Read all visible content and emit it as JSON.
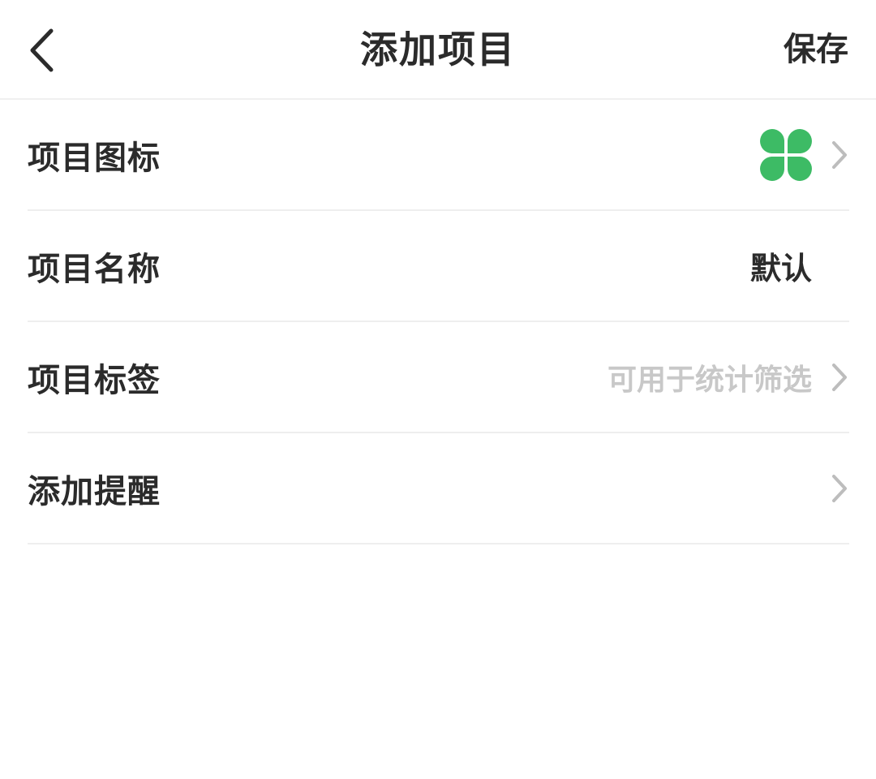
{
  "header": {
    "title": "添加项目",
    "save_label": "保存",
    "back_icon": "chevron-left-icon"
  },
  "rows": [
    {
      "label": "项目图标",
      "icon": "clover-icon",
      "icon_color": "#3dbb65",
      "has_chevron": true
    },
    {
      "label": "项目名称",
      "value": "默认",
      "has_chevron": false
    },
    {
      "label": "项目标签",
      "placeholder": "可用于统计筛选",
      "has_chevron": true
    },
    {
      "label": "添加提醒",
      "has_chevron": true
    }
  ],
  "colors": {
    "text": "#2b2b2b",
    "placeholder": "#c8c8c8",
    "chevron": "#bdbdbd",
    "divider": "#eeeeee",
    "accent_green": "#3dbb65"
  }
}
